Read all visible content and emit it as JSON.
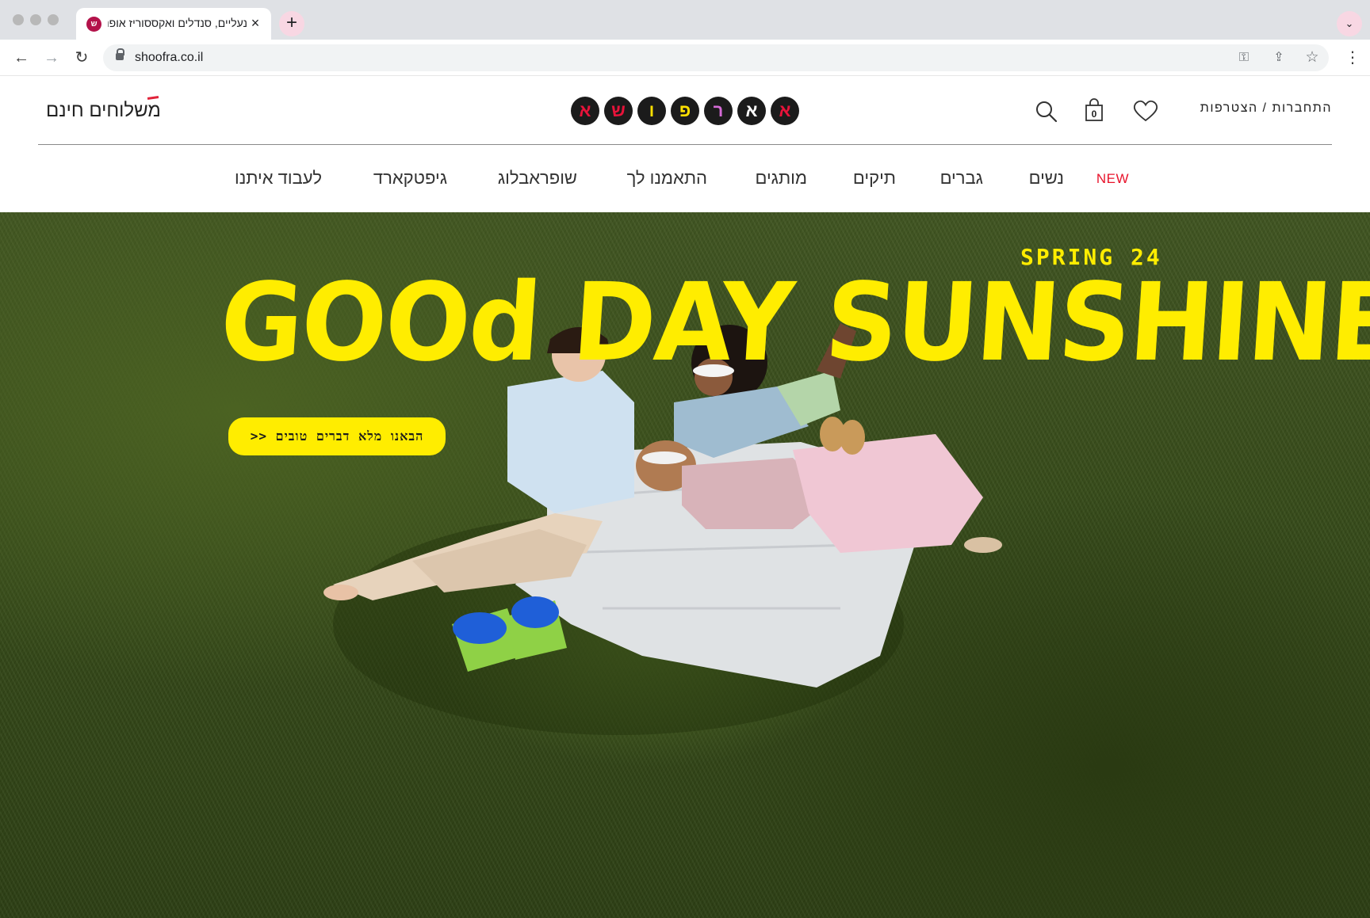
{
  "browser": {
    "tab_title": "נעליים, סנדלים ואקססוריז אופנתיות במשלוח חינם עד הבית",
    "tab_favicon": "ש",
    "tab_close": "×",
    "new_tab": "+",
    "tab_menu": "⌄",
    "url": "shoofra.co.il",
    "back": "←",
    "forward": "→",
    "reload": "↻",
    "key_icon": "⚿",
    "share_icon": "⇪",
    "bookmark_icon": "☆",
    "menu_icon": "⋮"
  },
  "header": {
    "free_shipping": "משלוחים חינם",
    "logo_letters": [
      {
        "char": "א",
        "color": "#e8133a"
      },
      {
        "char": "ש",
        "color": "#e8133a"
      },
      {
        "char": "ו",
        "color": "#ffe000"
      },
      {
        "char": "פ",
        "color": "#ffe000"
      },
      {
        "char": "ר",
        "color": "#d56bd6"
      },
      {
        "char": "א",
        "color": "#ffffff"
      },
      {
        "char": "א",
        "color": "#e8133a"
      }
    ],
    "cart_count": "0",
    "account": "התחברות / הצטרפות"
  },
  "nav": {
    "items": [
      "NEW",
      "נשים",
      "גברים",
      "תיקים",
      "מותגים",
      "התאמנו לך",
      "שופראבלוג",
      "גיפטקארד",
      "לעבוד איתנו"
    ]
  },
  "hero": {
    "season": "SPRING 24",
    "headline": "GOOd DAY SUNSHINE",
    "cta": "הבאנו מלא דברים טובים <<"
  },
  "colors": {
    "brand_yellow": "#ffed00",
    "accent_red": "#e8132b",
    "grass": "#364b19"
  }
}
